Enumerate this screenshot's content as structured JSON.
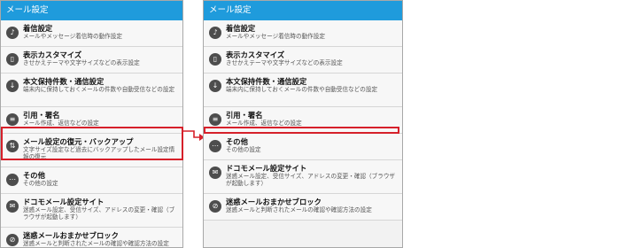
{
  "left": {
    "title": "メール設定",
    "items": [
      {
        "title": "着信設定",
        "sub": "メールやメッセージ着信時の動作設定",
        "icon": "music-note-icon"
      },
      {
        "title": "表示カスタマイズ",
        "sub": "きせかえテーマや文字サイズなどの表示設定",
        "icon": "phone-icon"
      },
      {
        "title": "本文保持件数・通信設定",
        "sub": "端末内に保持しておくメールの件数や自動受信などの設定",
        "icon": "download-icon"
      },
      {
        "title": "引用・署名",
        "sub": "メール作成、返信などの設定",
        "icon": "document-icon"
      },
      {
        "title": "メール設定の復元・バックアップ",
        "sub": "文字サイズ設定など過去にバックアップしたメール設定情報の復元",
        "icon": "sync-icon"
      },
      {
        "title": "その他",
        "sub": "その他の設定",
        "icon": "more-icon"
      },
      {
        "title": "ドコモメール設定サイト",
        "sub": "迷惑メール設定、受信サイズ、アドレスの変更・確認（ブラウザが起動します）",
        "icon": "mail-icon"
      },
      {
        "title": "迷惑メールおまかせブロック",
        "sub": "迷惑メールと判断されたメールの確認や確認方法の設定",
        "icon": "block-icon"
      }
    ]
  },
  "right": {
    "title": "メール設定",
    "items": [
      {
        "title": "着信設定",
        "sub": "メールやメッセージ着信時の動作設定",
        "icon": "music-note-icon"
      },
      {
        "title": "表示カスタマイズ",
        "sub": "きせかえテーマや文字サイズなどの表示設定",
        "icon": "phone-icon"
      },
      {
        "title": "本文保持件数・通信設定",
        "sub": "端末内に保持しておくメールの件数や自動受信などの設定",
        "icon": "download-icon"
      },
      {
        "title": "引用・署名",
        "sub": "メール作成、返信などの設定",
        "icon": "document-icon"
      },
      {
        "title": "その他",
        "sub": "その他の設定",
        "icon": "more-icon"
      },
      {
        "title": "ドコモメール設定サイト",
        "sub": "迷惑メール設定、受信サイズ、アドレスの変更・確認（ブラウザが起動します）",
        "icon": "mail-icon"
      },
      {
        "title": "迷惑メールおまかせブロック",
        "sub": "迷惑メールと判断されたメールの確認や確認方法の設定",
        "icon": "block-icon"
      }
    ]
  },
  "colors": {
    "header": "#1f9bdc",
    "highlight": "#d6202a"
  }
}
